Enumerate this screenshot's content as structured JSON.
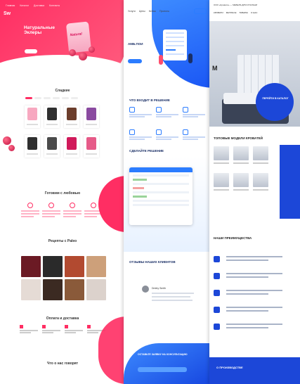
{
  "panel_left": {
    "nav": [
      "Главная",
      "Каталог",
      "Доставка",
      "Контакты"
    ],
    "logo": "Sw",
    "hero_title": "Натуральные Эклеры",
    "hero_subtitle": "",
    "product_label": "Natural",
    "section_products": "Сладкие",
    "section_features": "Готовим с любовью",
    "section_recipes": "Рецепты с Paleo",
    "section_payment": "Оплата и доставка",
    "section_reviews": "Что о нас говорят",
    "product_colors": [
      "#f7a8c0",
      "#2f2f2f",
      "#6b3d2b",
      "#8a4aa0",
      "#2f2f2f",
      "#4a4a4a",
      "#d0195a",
      "#e65a88"
    ],
    "photo_colors": [
      "#6b1a24",
      "#2a2a2a",
      "#b24a30",
      "#cda07a",
      "#e5dbd5",
      "#3b2a22",
      "#8a5a3a",
      "#dcd2cc"
    ]
  },
  "panel_middle": {
    "nav": [
      "Услуги",
      "Цены",
      "Кейсы",
      "Проекты"
    ],
    "hero_title": "АМБ.ПОИ",
    "section_steps": "ЧТО ВХОДИТ В РЕШЕНИЕ",
    "section_dashboard": "СДЕЛАЙТЕ РЕШЕНИЕ",
    "section_reviews": "ОТЗЫВЫ НАШИХ КЛИЕНТОВ",
    "reviewer": "Dmitry Smith",
    "footer_title": "ОСТАВЬТЕ ЗАЯВКУ НА КОНСУЛЬТАЦИЮ"
  },
  "panel_right": {
    "nav_top": "ООО «Кровати» — МЕБЕЛЬ ДЛЯ СПАЛЬНИ",
    "nav": [
      "КРОВАТИ",
      "МАТРАСЫ",
      "ТОВАРЫ",
      "О НАС"
    ],
    "hero_word": "М",
    "circle_text": "ПЕРЕЙТИ В КАТАЛОГ",
    "section_models": "ТОПОВЫЕ МОДЕЛИ КРОВАТЕЙ",
    "section_advantages": "НАШИ ПРЕИМУЩЕСТВА",
    "footer": "О ПРОИЗВОДСТВЕ"
  },
  "colors": {
    "pink": "#ff2e63",
    "blue": "#2b7cff",
    "navy": "#1c47d8"
  }
}
